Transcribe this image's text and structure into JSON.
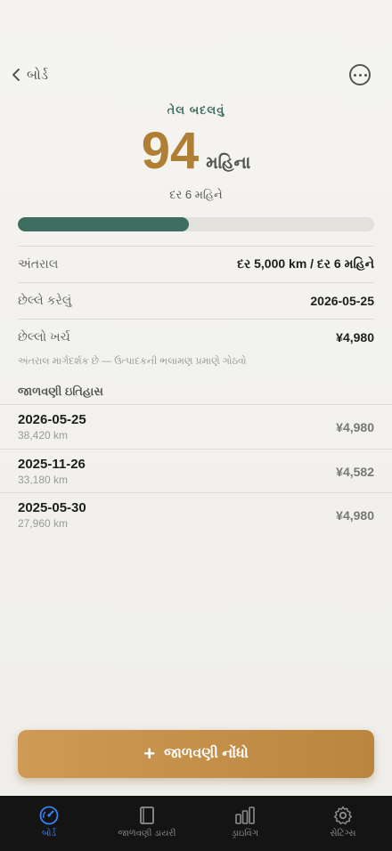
{
  "nav": {
    "back_label": "બોર્ડ"
  },
  "hero": {
    "subtitle": "તેલ બદલવું",
    "value": "94",
    "unit": "મહિના",
    "frequency": "દર 6 મહિને",
    "progress": 0.48
  },
  "details": [
    {
      "label": "અંતરાલ",
      "value": "દર 5,000 km / દર 6 મહિને"
    },
    {
      "label": "છેલ્લે કરેલું",
      "value": "2026-05-25"
    },
    {
      "label": "છેલ્લો ખર્ચ",
      "value": "¥4,980"
    }
  ],
  "note": "અંતરાલ માર્ગદર્શક છે — ઉત્પાદકની ભલામણ પ્રમાણે ગોઠવો",
  "history": {
    "title": "જાળવણી ઇતિહાસ",
    "items": [
      {
        "date": "2026-05-25",
        "km": "38,420 km",
        "cost": "¥4,980"
      },
      {
        "date": "2025-11-26",
        "km": "33,180 km",
        "cost": "¥4,582"
      },
      {
        "date": "2025-05-30",
        "km": "27,960 km",
        "cost": "¥4,980"
      }
    ]
  },
  "cta": {
    "label": "જાળવણી નોંધો"
  },
  "tabs": [
    {
      "label": "બોર્ડ",
      "icon": "gauge-icon"
    },
    {
      "label": "જાળવણી ડાયરી",
      "icon": "book-icon"
    },
    {
      "label": "ડ્રાઇવિંગ",
      "icon": "bars-icon"
    },
    {
      "label": "સેટિંગ્સ",
      "icon": "gear-icon"
    }
  ],
  "colors": {
    "accent": "#b07f33",
    "green": "#3f6e60",
    "tab_active": "#3b82f6"
  }
}
